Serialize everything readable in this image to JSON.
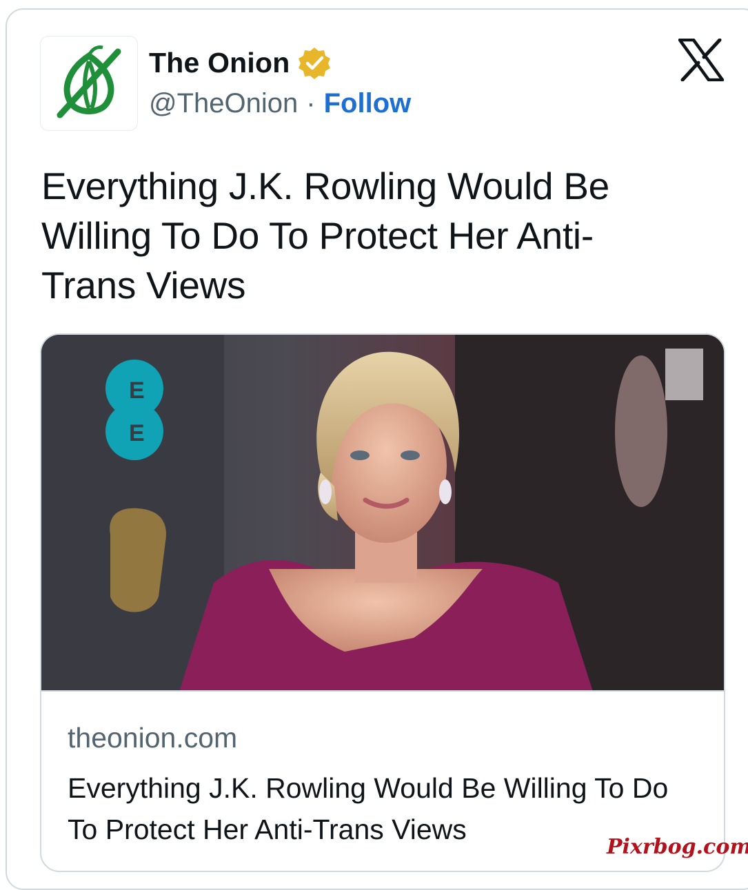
{
  "author": {
    "display_name": "The Onion",
    "handle": "@TheOnion",
    "separator": "·",
    "follow_label": "Follow",
    "avatar_icon": "onion-logo-icon",
    "badge_icon": "verified-badge-icon"
  },
  "platform_icon": "x-logo-icon",
  "tweet": {
    "text": "Everything J.K. Rowling Would Be Willing To Do To Protect Her Anti-Trans Views"
  },
  "link_card": {
    "image_icon": "article-photo",
    "domain": "theonion.com",
    "title": "Everything J.K. Rowling Would Be Willing To Do To Protect Her Anti-Trans Views"
  },
  "watermark": "Pixrbog.com",
  "colors": {
    "follow_blue": "#1d6fd1",
    "onion_green": "#1f8f3a",
    "badge_gold": "#e8b62a",
    "dress_magenta": "#8a1f5a",
    "ee_teal": "#0fa3b5"
  }
}
